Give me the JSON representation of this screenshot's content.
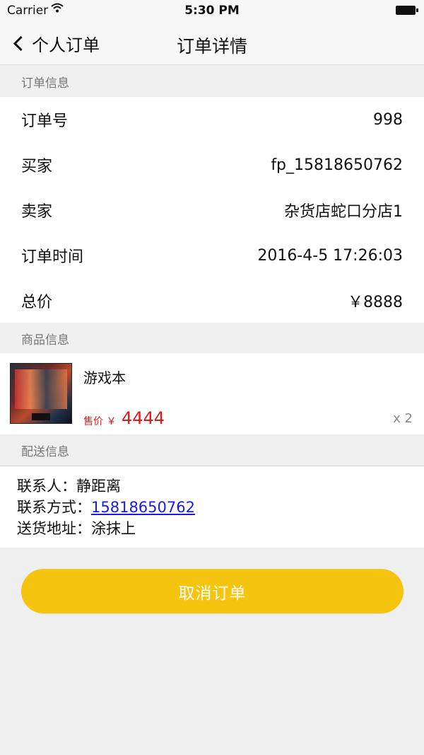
{
  "status_bar": {
    "carrier": "Carrier",
    "time": "5:30 PM"
  },
  "nav": {
    "back_label": "个人订单",
    "title": "订单详情"
  },
  "order_section": {
    "header": "订单信息",
    "rows": [
      {
        "label": "订单号",
        "value": "998"
      },
      {
        "label": "买家",
        "value": "fp_15818650762"
      },
      {
        "label": "卖家",
        "value": "杂货店蛇口分店1"
      },
      {
        "label": "订单时间",
        "value": "2016-4-5 17:26:03"
      },
      {
        "label": "总价",
        "value": "￥8888"
      }
    ]
  },
  "product_section": {
    "header": "商品信息",
    "name": "游戏本",
    "price_label": "售价 ￥",
    "price": "4444",
    "quantity": "x 2"
  },
  "delivery_section": {
    "header": "配送信息",
    "contact_label": "联系人：",
    "contact": "静距离",
    "phone_label": "联系方式：",
    "phone": "15818650762",
    "address_label": "送货地址：",
    "address": "涂抹上"
  },
  "cancel_button": "取消订单",
  "colors": {
    "accent": "#f5c40f",
    "price": "#e01818",
    "link": "#1a1aee"
  }
}
